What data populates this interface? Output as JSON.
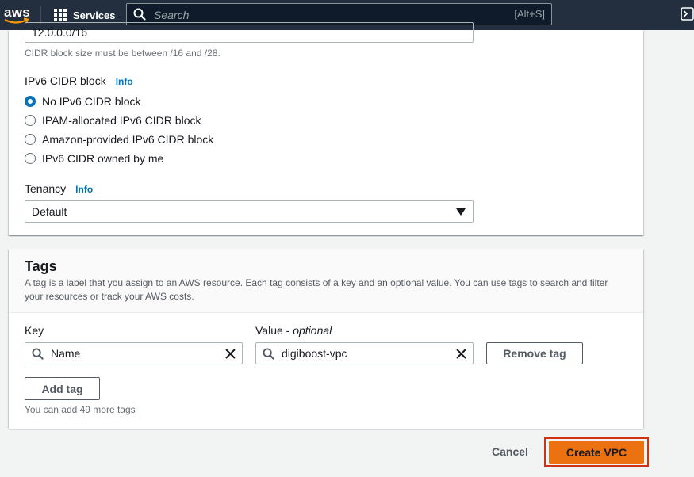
{
  "nav": {
    "logo_text": "aws",
    "services_label": "Services",
    "search_placeholder": "Search",
    "search_shortcut": "[Alt+S]"
  },
  "vpc": {
    "ipv4_cidr_value": "12.0.0.0/16",
    "ipv4_cidr_hint": "CIDR block size must be between /16 and /28.",
    "ipv6_label": "IPv6 CIDR block",
    "info_label": "Info",
    "ipv6_options": [
      {
        "label": "No IPv6 CIDR block",
        "selected": true
      },
      {
        "label": "IPAM-allocated IPv6 CIDR block",
        "selected": false
      },
      {
        "label": "Amazon-provided IPv6 CIDR block",
        "selected": false
      },
      {
        "label": "IPv6 CIDR owned by me",
        "selected": false
      }
    ],
    "tenancy_label": "Tenancy",
    "tenancy_value": "Default"
  },
  "tags": {
    "title": "Tags",
    "description": "A tag is a label that you assign to an AWS resource. Each tag consists of a key and an optional value. You can use tags to search and filter your resources or track your AWS costs.",
    "key_label": "Key",
    "value_label": "Value - ",
    "value_optional": "optional",
    "rows": [
      {
        "key": "Name",
        "value": "digiboost-vpc"
      }
    ],
    "remove_label": "Remove tag",
    "add_label": "Add tag",
    "remaining_hint": "You can add 49 more tags"
  },
  "footer": {
    "cancel_label": "Cancel",
    "create_label": "Create VPC"
  },
  "colors": {
    "nav_bg": "#232f3e",
    "primary_button": "#ec7211",
    "link": "#0073bb",
    "highlight_frame": "#d13212"
  }
}
